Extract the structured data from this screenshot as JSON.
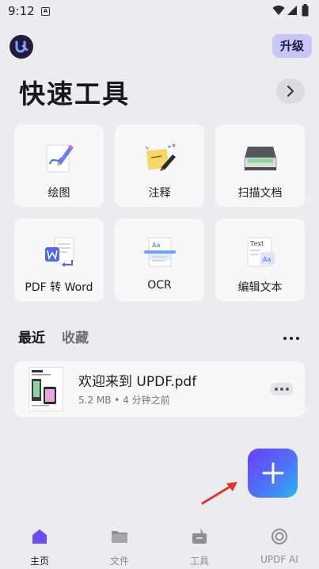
{
  "status_bar": {
    "time": "9:12",
    "notification_letter": "A"
  },
  "header": {
    "upgrade_label": "升级"
  },
  "quick_tools": {
    "title": "快速工具",
    "tools": [
      {
        "label": "绘图",
        "icon": "draw-icon"
      },
      {
        "label": "注释",
        "icon": "annotate-icon"
      },
      {
        "label": "扫描文档",
        "icon": "scanner-icon"
      },
      {
        "label": "PDF 转 Word",
        "icon": "pdf-to-word-icon"
      },
      {
        "label": "OCR",
        "icon": "ocr-icon"
      },
      {
        "label": "编辑文本",
        "icon": "edit-text-icon"
      }
    ]
  },
  "files_section": {
    "tabs": [
      "最近",
      "收藏"
    ],
    "files": [
      {
        "name": "欢迎来到 UPDF.pdf",
        "meta": "5.2 MB • 4 分钟之前"
      }
    ]
  },
  "bottom_nav": {
    "items": [
      {
        "label": "主页",
        "icon": "home-icon",
        "active": true
      },
      {
        "label": "文件",
        "icon": "folder-icon",
        "active": false
      },
      {
        "label": "工具",
        "icon": "toolbox-icon",
        "active": false
      },
      {
        "label": "UPDF AI",
        "icon": "ai-icon",
        "active": false
      }
    ]
  },
  "colors": {
    "accent": "#6a3ef5",
    "upgrade_bg": "#c8c5f7",
    "arrow": "#e0352b"
  }
}
